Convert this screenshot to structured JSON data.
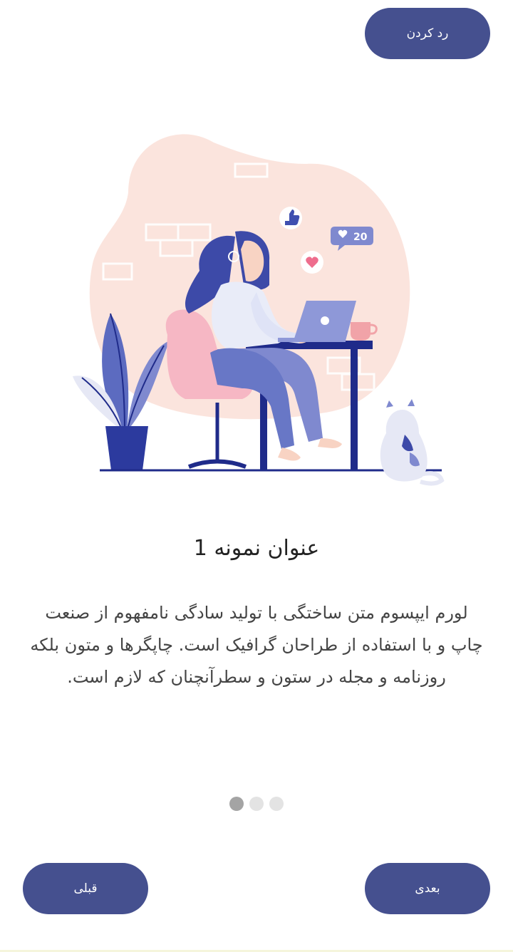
{
  "header": {
    "skip_label": "رد کردن"
  },
  "illustration": {
    "name": "woman-working-on-laptop-illustration",
    "notification_count": "20",
    "colors": {
      "blob": "#fbe4dd",
      "navy": "#1f2b8a",
      "lavender": "#7f89cf",
      "pink": "#f6b7c4",
      "hair": "#3d4aa8"
    }
  },
  "content": {
    "title": "عنوان نمونه 1",
    "body": "لورم ایپسوم متن ساختگی با تولید سادگی نامفهوم از صنعت چاپ و با استفاده از طراحان گرافیک است. چاپگرها و متون بلکه روزنامه و مجله در ستون و سطرآنچنان که لازم است."
  },
  "pager": {
    "total": 3,
    "active_index": 0
  },
  "footer": {
    "next_label": "بعدی",
    "prev_label": "قبلی"
  },
  "theme": {
    "accent": "#45508f",
    "dot_active": "#a4a4a4",
    "dot_inactive": "#e3e3e3"
  }
}
